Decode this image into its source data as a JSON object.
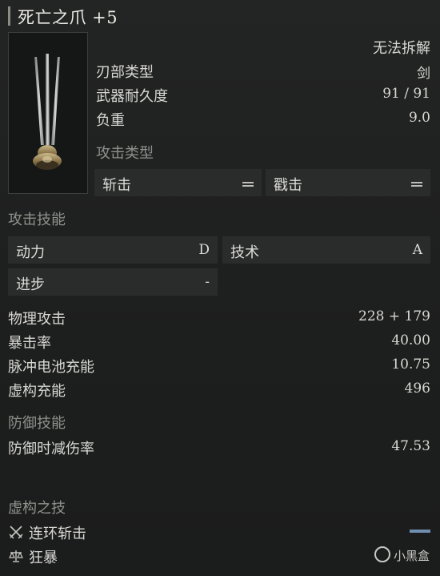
{
  "title": "死亡之爪 +5",
  "weapon": {
    "dismantle": "无法拆解",
    "stats": [
      {
        "label": "刃部类型",
        "value": "剑"
      },
      {
        "label": "武器耐久度",
        "value": "91 / 91"
      },
      {
        "label": "负重",
        "value": "9.0"
      }
    ],
    "attack_type_header": "攻击类型",
    "attack_types": [
      "斩击",
      "戳击"
    ]
  },
  "attack_skill": {
    "header": "攻击技能",
    "cells": [
      {
        "label": "动力",
        "value": "D"
      },
      {
        "label": "技术",
        "value": "A"
      },
      {
        "label": "进步",
        "value": "-"
      }
    ]
  },
  "attack_stats": [
    {
      "label": "物理攻击",
      "value": "228 + 179"
    },
    {
      "label": "暴击率",
      "value": "40.00"
    },
    {
      "label": "脉冲电池充能",
      "value": "10.75"
    },
    {
      "label": "虚构充能",
      "value": "496"
    }
  ],
  "defense": {
    "header": "防御技能",
    "stats": [
      {
        "label": "防御时减伤率",
        "value": "47.53"
      }
    ]
  },
  "fable": {
    "header": "虚构之技",
    "skills": [
      {
        "label": "连环斩击",
        "icon": "crossed-swords-icon"
      },
      {
        "label": "狂暴",
        "icon": "scales-icon"
      }
    ],
    "bar_color": "#6f8eb0"
  },
  "watermark": "小黑盒"
}
